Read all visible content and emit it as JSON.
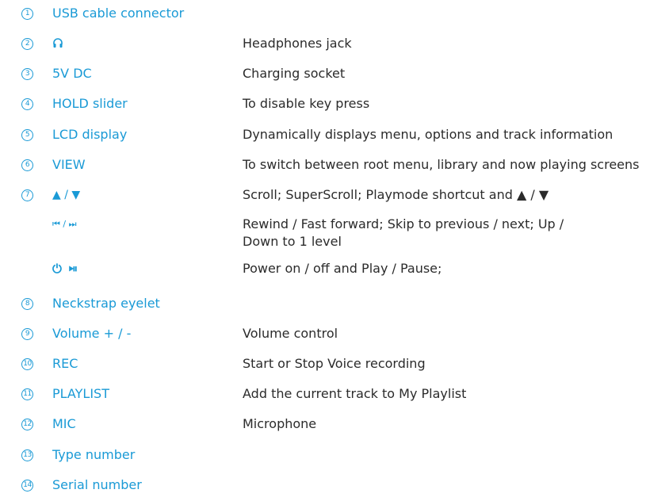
{
  "accent_color": "#1a9ad6",
  "rows": [
    {
      "num": "1",
      "label": "USB cable connector",
      "desc": ""
    },
    {
      "num": "2",
      "label": "",
      "icon": "headphones-icon",
      "desc": "Headphones jack"
    },
    {
      "num": "3",
      "label": "5V DC",
      "desc": "Charging socket"
    },
    {
      "num": "4",
      "label": "HOLD slider",
      "desc": "To disable key press"
    },
    {
      "num": "5",
      "label": "LCD display",
      "desc": "Dynamically displays menu, options and track information"
    },
    {
      "num": "6",
      "label": "VIEW",
      "desc": "To switch between root menu, library and now playing screens"
    },
    {
      "num": "7",
      "label": "▲ / ▼",
      "desc": "Scroll; SuperScroll; Playmode shortcut and ▲ / ▼"
    },
    {
      "num": "",
      "label": "⏮ / ⏭",
      "desc": "Rewind / Fast forward; Skip to previous / next; Up /\nDown to 1 level"
    },
    {
      "num": "",
      "label": "⏻ ⏯",
      "desc": "Power on / off and Play / Pause;"
    },
    {
      "num": "8",
      "label": "Neckstrap eyelet",
      "desc": ""
    },
    {
      "num": "9",
      "label": "Volume + / -",
      "desc": "Volume control"
    },
    {
      "num": "10",
      "label": "REC",
      "desc": "Start or Stop Voice recording"
    },
    {
      "num": "11",
      "label": "PLAYLIST",
      "desc": "Add the current track to My Playlist"
    },
    {
      "num": "12",
      "label": "MIC",
      "desc": "Microphone"
    },
    {
      "num": "13",
      "label": "Type number",
      "desc": ""
    },
    {
      "num": "14",
      "label": "Serial number",
      "desc": ""
    }
  ]
}
